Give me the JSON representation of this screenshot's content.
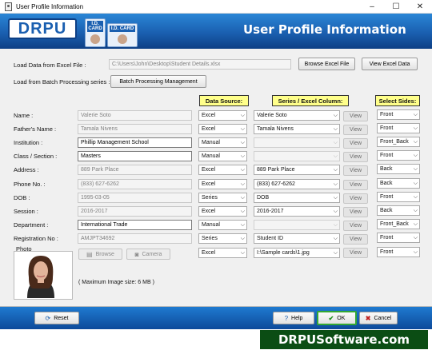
{
  "window": {
    "title": "User Profile Information",
    "minimize": "–",
    "maximize": "☐",
    "close": "✕"
  },
  "banner": {
    "logo": "DRPU",
    "card1": "I.D. CARD",
    "card2": "I.D. CARD",
    "title": "User Profile Information"
  },
  "excel": {
    "label": "Load Data from Excel File :",
    "path": "C:\\Users\\John\\Desktop\\Student Details.xlsx",
    "browse": "Browse Excel File",
    "view": "View Excel Data"
  },
  "batch": {
    "label": "Load from Batch Processing series :",
    "button": "Batch Processing Management"
  },
  "headers": {
    "data_source": "Data Source:",
    "series_column": "Series / Excel Column:",
    "select_sides": "Select Sides:"
  },
  "rows": [
    {
      "label": "Name :",
      "value": "Valerie Soto",
      "active": false,
      "source": "Excel",
      "column": "Valerie Soto",
      "view": "View",
      "side": "Front"
    },
    {
      "label": "Father's Name :",
      "value": "Tamala Nivens",
      "active": false,
      "source": "Excel",
      "column": "Tamala Nivens",
      "view": "View",
      "side": "Front"
    },
    {
      "label": "Institution :",
      "value": "Phillip Management School",
      "active": true,
      "source": "Manual",
      "column": "",
      "view": "View",
      "side": "Front_Back"
    },
    {
      "label": "Class / Section :",
      "value": "Masters",
      "active": true,
      "source": "Manual",
      "column": "",
      "view": "View",
      "side": "Front"
    },
    {
      "label": "Address :",
      "value": "889 Park Place",
      "active": false,
      "source": "Excel",
      "column": "889 Park Place",
      "view": "View",
      "side": "Back"
    },
    {
      "label": "Phone No. :",
      "value": "(833) 627-6262",
      "active": false,
      "source": "Excel",
      "column": "(833) 627-6262",
      "view": "View",
      "side": "Back"
    },
    {
      "label": "DOB :",
      "value": "1995-03-05",
      "active": false,
      "source": "Series",
      "column": "DOB",
      "view": "View",
      "side": "Front"
    },
    {
      "label": "Session :",
      "value": "2016-2017",
      "active": false,
      "source": "Excel",
      "column": "2016-2017",
      "view": "View",
      "side": "Back"
    },
    {
      "label": "Department :",
      "value": "International Trade",
      "active": true,
      "source": "Manual",
      "column": "",
      "view": "View",
      "side": "Front_Back"
    },
    {
      "label": "Registration No :",
      "value": "AMJPT34692",
      "active": false,
      "source": "Series",
      "column": "Student ID",
      "view": "View",
      "side": "Front"
    }
  ],
  "photo": {
    "label": "Photo",
    "browse": "Browse",
    "camera": "Camera",
    "source": "Excel",
    "column": "I:\\Sample cards\\1.jpg",
    "view": "View",
    "side": "Front",
    "max_size": "( Maximum Image size: 6 MB )"
  },
  "buttons": {
    "reset": "Reset",
    "help": "Help",
    "ok": "OK",
    "cancel": "Cancel"
  },
  "footer": {
    "brand": "DRPUSoftware.com"
  },
  "colors": {
    "banner": "#1a5fb0",
    "header_fill": "#ffff8a",
    "ok_border": "#33a833",
    "brand_bg": "#0b4d14"
  }
}
